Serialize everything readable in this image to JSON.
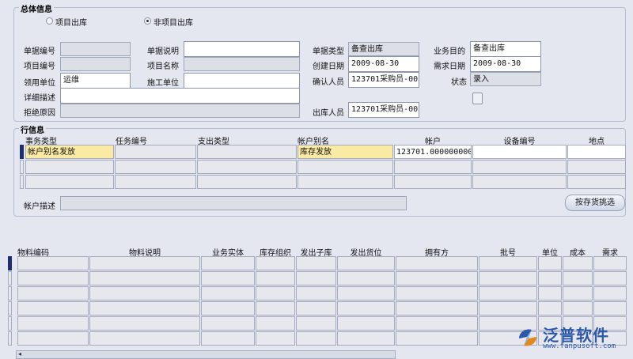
{
  "header_group": {
    "title": "总体信息",
    "radio_project": "项目出库",
    "radio_nonproject": "非项目出库",
    "labels": {
      "doc_no": "单据编号",
      "doc_desc": "单据说明",
      "doc_type": "单据类型",
      "biz_purpose": "业务目的",
      "project_no": "项目编号",
      "project_name": "项目名称",
      "created_date": "创建日期",
      "demand_date": "需求日期",
      "recv_unit": "领用单位",
      "construct_unit": "施工单位",
      "confirmer": "确认人员",
      "status": "状态",
      "detail_desc": "详细描述",
      "reject_reason": "拒绝原因",
      "out_person": "出库人员"
    },
    "values": {
      "doc_type": "备查出库",
      "biz_purpose": "备查出库",
      "created_date": "2009-08-30",
      "demand_date": "2009-08-30",
      "recv_unit": "运维",
      "confirmer": "123701采购员-003",
      "status": "录入",
      "out_person": "123701采购员-003"
    }
  },
  "line_group": {
    "title": "行信息",
    "columns": [
      "事务类型",
      "任务编号",
      "支出类型",
      "帐户别名",
      "帐户",
      "设备编号",
      "地点"
    ],
    "row1": {
      "trans_type": "帐户别名发放",
      "account_alias": "库存发放",
      "account": "123701.0000000000"
    },
    "account_desc_label": "帐户描述",
    "button_label": "按存货挑选"
  },
  "bottom_table": {
    "columns": [
      "物料编码",
      "物料说明",
      "业务实体",
      "库存组织",
      "发出子库",
      "发出货位",
      "拥有方",
      "批号",
      "单位",
      "成本",
      "需求"
    ]
  },
  "logo": {
    "name": "泛普软件",
    "url": "www.fanpusoft.com"
  }
}
